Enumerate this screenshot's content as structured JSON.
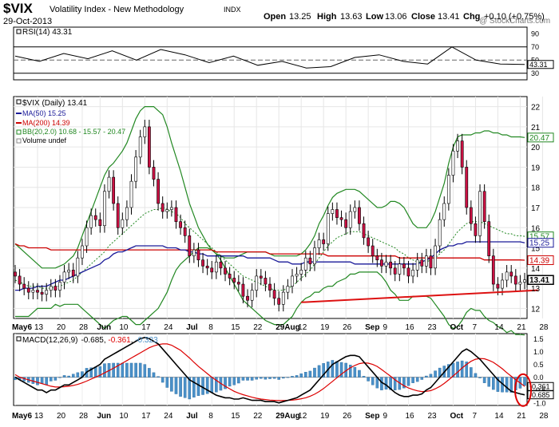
{
  "header": {
    "symbol": "$VIX",
    "name": "Volatility Index - New Methodology",
    "exchange": "INDX",
    "date": "29-Oct-2013",
    "copyright": "@ StockCharts.com",
    "open_label": "Open",
    "open": "13.25",
    "high_label": "High",
    "high": "13.63",
    "low_label": "Low",
    "low": "13.06",
    "close_label": "Close",
    "close": "13.41",
    "chg_label": "Chg",
    "chg": "+0.10 (+0.75%)"
  },
  "colors": {
    "up_candle": "#ffffff",
    "down_candle": "#cc1144",
    "ma50": "#1a1a99",
    "ma200": "#cc0000",
    "bb": "#228822",
    "bb_mid": "#228822",
    "trendline": "#dd1111",
    "macd": "#000000",
    "signal": "#dd0000",
    "histogram": "#4a90c8",
    "circle": "#dd0000"
  },
  "chart_data": [
    {
      "type": "line",
      "panel": "rsi",
      "legend": "RSI(14) 43.31",
      "yticks": [
        30,
        50,
        70,
        90
      ],
      "ylim": [
        20,
        100
      ],
      "reference_lines": [
        30,
        70
      ],
      "last_value_label": "43.31",
      "x": [
        0,
        6,
        12,
        18,
        24,
        30,
        36,
        42,
        48,
        54,
        60,
        66,
        72,
        78,
        84,
        90,
        96,
        102,
        108,
        114,
        120,
        126
      ],
      "values": [
        56,
        48,
        60,
        52,
        64,
        50,
        66,
        58,
        46,
        56,
        42,
        48,
        38,
        40,
        54,
        58,
        48,
        44,
        70,
        50,
        44,
        43.31
      ]
    },
    {
      "type": "candlestick",
      "panel": "price",
      "legend": [
        "$VIX (Daily) 13.41",
        "MA(50) 15.25",
        "MA(200) 14.39",
        "BB(20,2.0) 10.68 - 15.57 - 20.47",
        "Volume undef"
      ],
      "ylim": [
        11.5,
        22.5
      ],
      "yticks": [
        12,
        13,
        14,
        15,
        16,
        17,
        18,
        19,
        20,
        21,
        22
      ],
      "value_labels": [
        {
          "text": "20.47",
          "value": 20.47
        },
        {
          "text": "15.57",
          "value": 15.57
        },
        {
          "text": "15.25",
          "value": 15.25
        },
        {
          "text": "14.39",
          "value": 14.39
        },
        {
          "text": "13.41",
          "value": 13.41
        }
      ],
      "x_tick_labels": [
        "May6",
        "13",
        "20",
        "28",
        "Jun",
        "10",
        "17",
        "24",
        "Jul",
        "8",
        "15",
        "22",
        "29Aug",
        "12",
        "19",
        "26",
        "Sep",
        "9",
        "16",
        "23",
        "Oct",
        "7",
        "14",
        "21",
        "28"
      ],
      "x_tick_days": [
        0,
        5,
        10,
        15,
        19,
        24,
        29,
        34,
        39,
        44,
        49,
        54,
        59,
        64,
        69,
        74,
        79,
        83,
        88,
        93,
        98,
        103,
        108,
        113,
        118
      ],
      "close": [
        13.6,
        13.2,
        13.0,
        12.8,
        12.9,
        12.8,
        12.7,
        12.9,
        13.1,
        12.9,
        13.3,
        13.8,
        13.9,
        13.6,
        14.5,
        15.1,
        16.0,
        16.6,
        16.4,
        16.1,
        17.8,
        18.5,
        17.2,
        16.0,
        16.4,
        17.0,
        18.3,
        19.5,
        20.5,
        21.0,
        19.0,
        18.4,
        17.2,
        16.8,
        16.9,
        17.0,
        16.3,
        16.0,
        15.6,
        14.6,
        14.9,
        14.4,
        14.1,
        14.0,
        13.8,
        14.3,
        14.0,
        13.7,
        13.5,
        13.3,
        13.2,
        12.6,
        12.4,
        12.9,
        13.6,
        13.5,
        13.2,
        12.9,
        12.5,
        12.2,
        12.8,
        13.1,
        13.6,
        13.7,
        13.9,
        14.5,
        14.2,
        15.0,
        15.4,
        15.2,
        16.7,
        16.9,
        16.5,
        16.4,
        16.0,
        16.8,
        17.0,
        16.2,
        15.5,
        15.1,
        14.6,
        14.4,
        14.1,
        14.3,
        14.0,
        13.7,
        14.2,
        14.0,
        13.6,
        13.9,
        14.4,
        14.1,
        14.6,
        14.0,
        15.1,
        16.4,
        17.2,
        18.6,
        19.8,
        20.3,
        19.0,
        17.0,
        16.2,
        15.6,
        17.8,
        16.3,
        14.6,
        13.2,
        13.0,
        13.4,
        13.8,
        13.6,
        13.2,
        13.3,
        13.41
      ],
      "ma50": [
        12.9,
        12.9,
        13.0,
        13.0,
        13.0,
        13.1,
        13.1,
        13.1,
        13.2,
        13.3,
        13.4,
        13.4,
        13.5,
        13.6,
        13.7,
        13.8,
        13.9,
        14.0,
        14.1,
        14.2,
        14.4,
        14.5,
        14.7,
        14.8,
        14.8,
        14.9,
        15.0,
        15.1,
        15.1,
        15.1,
        15.1,
        15.1,
        15.1,
        15.1,
        15.0,
        15.0,
        15.0,
        14.9,
        14.9,
        14.8,
        14.8,
        14.7,
        14.7,
        14.6,
        14.6,
        14.6,
        14.6,
        14.6,
        14.6,
        14.6,
        14.6,
        14.6,
        14.5,
        14.5,
        14.5,
        14.5,
        14.5,
        14.5,
        14.4,
        14.3,
        14.3,
        14.3,
        14.2,
        14.2,
        14.2,
        14.3,
        14.3,
        14.3,
        14.3,
        14.3,
        14.3,
        14.3,
        14.3,
        14.3,
        14.3,
        14.3,
        14.2,
        14.2,
        14.2,
        14.2,
        14.2,
        14.2,
        14.2,
        14.2,
        14.2,
        14.2,
        14.2,
        14.2,
        14.2,
        14.2,
        14.2,
        14.3,
        14.4,
        14.5,
        14.7,
        14.9,
        15.0,
        15.1,
        15.1,
        15.2,
        15.2,
        15.3,
        15.3,
        15.3,
        15.3,
        15.3,
        15.3,
        15.3,
        15.3,
        15.3,
        15.3,
        15.3,
        15.3,
        15.3,
        15.25
      ],
      "ma200": [
        15.2,
        15.1,
        15.1,
        15.0,
        15.0,
        15.0,
        15.0,
        15.0,
        14.9,
        14.9,
        14.9,
        14.9,
        14.9,
        14.9,
        14.9,
        14.9,
        14.9,
        14.9,
        14.9,
        14.9,
        14.9,
        14.9,
        14.9,
        14.9,
        14.9,
        14.9,
        14.9,
        14.9,
        14.9,
        14.9,
        14.9,
        14.9,
        14.9,
        14.9,
        14.9,
        14.9,
        14.9,
        14.9,
        14.9,
        14.9,
        14.9,
        14.9,
        14.9,
        14.9,
        14.9,
        14.8,
        14.8,
        14.8,
        14.8,
        14.8,
        14.8,
        14.8,
        14.8,
        14.8,
        14.8,
        14.8,
        14.8,
        14.7,
        14.7,
        14.7,
        14.7,
        14.7,
        14.7,
        14.7,
        14.7,
        14.7,
        14.7,
        14.7,
        14.7,
        14.7,
        14.6,
        14.6,
        14.6,
        14.6,
        14.6,
        14.6,
        14.6,
        14.6,
        14.6,
        14.6,
        14.6,
        14.6,
        14.6,
        14.6,
        14.6,
        14.6,
        14.5,
        14.5,
        14.5,
        14.5,
        14.5,
        14.5,
        14.5,
        14.5,
        14.5,
        14.5,
        14.5,
        14.5,
        14.5,
        14.5,
        14.5,
        14.5,
        14.5,
        14.5,
        14.5,
        14.4,
        14.4,
        14.4,
        14.4,
        14.4,
        14.4,
        14.4,
        14.4,
        14.4,
        14.39
      ],
      "bb_upper": [
        15.2,
        15.0,
        14.8,
        14.6,
        14.4,
        14.2,
        14.0,
        14.0,
        14.0,
        14.0,
        14.1,
        14.2,
        14.4,
        14.6,
        15.0,
        15.6,
        16.2,
        16.8,
        17.4,
        18.0,
        18.6,
        19.0,
        19.2,
        19.5,
        19.8,
        20.2,
        20.8,
        21.4,
        21.8,
        22.0,
        22.0,
        22.0,
        21.8,
        21.6,
        21.0,
        20.2,
        19.5,
        18.8,
        18.0,
        17.2,
        16.6,
        16.0,
        15.6,
        15.2,
        14.9,
        14.7,
        14.6,
        14.5,
        14.5,
        14.5,
        14.6,
        14.7,
        14.8,
        14.8,
        14.8,
        14.8,
        14.8,
        14.7,
        14.6,
        14.6,
        14.6,
        14.6,
        14.6,
        14.6,
        14.7,
        14.9,
        15.2,
        15.6,
        16.2,
        16.6,
        17.1,
        17.5,
        17.7,
        17.8,
        17.9,
        17.9,
        17.9,
        17.8,
        17.6,
        17.4,
        17.2,
        17.0,
        17.0,
        17.1,
        17.3,
        17.3,
        17.2,
        17.0,
        16.6,
        16.2,
        16.0,
        16.0,
        16.0,
        16.3,
        16.8,
        17.5,
        18.2,
        19.2,
        20.0,
        20.5,
        20.6,
        20.6,
        20.6,
        20.7,
        20.7,
        20.8,
        20.8,
        20.7,
        20.7,
        20.6,
        20.6,
        20.5,
        20.5,
        20.5,
        20.47
      ],
      "bb_middle": [
        13.4,
        13.3,
        13.2,
        13.1,
        13.1,
        13.1,
        13.0,
        13.0,
        13.0,
        13.1,
        13.1,
        13.2,
        13.3,
        13.4,
        13.6,
        13.8,
        14.0,
        14.2,
        14.4,
        14.6,
        14.8,
        15.1,
        15.3,
        15.5,
        15.7,
        15.9,
        16.1,
        16.3,
        16.5,
        16.7,
        16.8,
        16.9,
        16.9,
        17.0,
        16.9,
        16.8,
        16.7,
        16.5,
        16.2,
        16.0,
        15.8,
        15.6,
        15.4,
        15.2,
        15.0,
        14.8,
        14.6,
        14.4,
        14.2,
        14.0,
        13.8,
        13.6,
        13.5,
        13.4,
        13.3,
        13.2,
        13.1,
        13.0,
        12.9,
        12.9,
        12.9,
        13.0,
        13.1,
        13.3,
        13.5,
        13.7,
        13.9,
        14.2,
        14.5,
        14.8,
        15.1,
        15.3,
        15.5,
        15.6,
        15.7,
        15.8,
        15.8,
        15.8,
        15.7,
        15.6,
        15.5,
        15.4,
        15.3,
        15.2,
        15.1,
        15.0,
        14.8,
        14.7,
        14.5,
        14.4,
        14.3,
        14.3,
        14.3,
        14.4,
        14.5,
        14.7,
        14.9,
        15.2,
        15.5,
        15.8,
        16.0,
        16.2,
        16.3,
        16.3,
        16.3,
        16.2,
        16.1,
        16.0,
        15.9,
        15.8,
        15.7,
        15.7,
        15.6,
        15.6,
        15.57
      ],
      "bb_lower": [
        11.6,
        11.6,
        11.6,
        11.6,
        11.8,
        12.0,
        12.0,
        12.0,
        12.0,
        12.2,
        12.1,
        12.2,
        12.2,
        12.2,
        12.2,
        12.0,
        11.8,
        11.6,
        11.4,
        11.2,
        11.0,
        11.2,
        11.4,
        11.5,
        11.6,
        11.6,
        11.4,
        11.2,
        11.2,
        11.4,
        11.6,
        11.8,
        12.0,
        12.4,
        12.8,
        13.4,
        13.9,
        14.2,
        14.4,
        14.6,
        14.8,
        15.0,
        15.0,
        15.0,
        14.9,
        14.7,
        14.4,
        14.0,
        13.6,
        13.2,
        12.8,
        12.4,
        12.2,
        12.0,
        11.8,
        11.6,
        11.4,
        11.3,
        11.2,
        11.2,
        11.2,
        11.4,
        11.6,
        12.0,
        12.3,
        12.5,
        12.6,
        12.8,
        12.8,
        13.0,
        13.1,
        13.1,
        13.3,
        13.4,
        13.5,
        13.7,
        13.7,
        13.8,
        13.8,
        13.8,
        13.8,
        13.8,
        13.6,
        13.3,
        12.9,
        12.7,
        12.4,
        12.4,
        12.4,
        12.6,
        12.6,
        12.6,
        12.6,
        12.5,
        12.2,
        11.9,
        11.6,
        11.2,
        11.0,
        11.1,
        11.4,
        11.8,
        12.0,
        11.9,
        11.9,
        11.6,
        11.4,
        11.3,
        11.1,
        11.0,
        10.8,
        10.9,
        10.7,
        10.7,
        10.68
      ],
      "trendline": {
        "x": [
          64,
          117
        ],
        "y": [
          12.3,
          12.9
        ]
      }
    },
    {
      "type": "line",
      "panel": "macd",
      "legend_prefix": "MACD(12,26,9)",
      "legend_macd": "-0.685",
      "legend_signal": "-0.361",
      "legend_hist": "-0.323",
      "ylim": [
        -1.1,
        1.7
      ],
      "yticks": [
        -1.0,
        -0.5,
        0.0,
        0.5,
        1.0
      ],
      "value_labels": [
        {
          "text": "1.5",
          "value": 1.5
        },
        {
          "text": "1.0",
          "value": 1.0
        },
        {
          "text": "0.5",
          "value": 0.5
        },
        {
          "text": "0.0",
          "value": 0.0
        },
        {
          "text": "-0.361",
          "value": -0.361
        },
        {
          "text": "-0.5",
          "value": -0.5
        },
        {
          "text": "-0.685",
          "value": -0.685
        },
        {
          "text": "-1.0",
          "value": -1.0
        }
      ],
      "macd": [
        0.0,
        -0.1,
        -0.2,
        -0.3,
        -0.4,
        -0.5,
        -0.5,
        -0.6,
        -0.5,
        -0.5,
        -0.4,
        -0.3,
        -0.3,
        -0.2,
        -0.1,
        0.0,
        0.2,
        0.3,
        0.4,
        0.5,
        0.7,
        0.8,
        0.9,
        1.0,
        1.1,
        1.2,
        1.3,
        1.4,
        1.5,
        1.55,
        1.5,
        1.4,
        1.3,
        1.1,
        0.9,
        0.7,
        0.5,
        0.3,
        0.1,
        -0.1,
        -0.2,
        -0.3,
        -0.4,
        -0.5,
        -0.6,
        -0.7,
        -0.75,
        -0.8,
        -0.8,
        -0.85,
        -0.85,
        -0.8,
        -0.85,
        -0.9,
        -0.9,
        -0.9,
        -0.95,
        -0.95,
        -0.95,
        -1.0,
        -0.95,
        -0.9,
        -0.85,
        -0.8,
        -0.7,
        -0.6,
        -0.5,
        -0.3,
        -0.1,
        0.1,
        0.3,
        0.5,
        0.6,
        0.7,
        0.8,
        0.85,
        0.85,
        0.8,
        0.6,
        0.4,
        0.2,
        0.0,
        -0.2,
        -0.3,
        -0.45,
        -0.6,
        -0.7,
        -0.75,
        -0.75,
        -0.7,
        -0.7,
        -0.65,
        -0.5,
        -0.4,
        -0.2,
        0.0,
        0.2,
        0.4,
        0.6,
        0.8,
        1.0,
        1.1,
        1.0,
        0.85,
        0.7,
        0.5,
        0.3,
        0.1,
        -0.1,
        -0.25,
        -0.4,
        -0.55,
        -0.6,
        -0.65,
        -0.685
      ],
      "signal": [
        0.1,
        0.0,
        -0.05,
        -0.1,
        -0.15,
        -0.2,
        -0.25,
        -0.3,
        -0.35,
        -0.38,
        -0.38,
        -0.37,
        -0.35,
        -0.32,
        -0.28,
        -0.22,
        -0.15,
        -0.07,
        0.0,
        0.08,
        0.17,
        0.26,
        0.35,
        0.45,
        0.55,
        0.65,
        0.75,
        0.85,
        0.95,
        1.05,
        1.15,
        1.22,
        1.27,
        1.3,
        1.3,
        1.25,
        1.15,
        1.05,
        0.9,
        0.75,
        0.58,
        0.42,
        0.28,
        0.14,
        0.0,
        -0.12,
        -0.24,
        -0.35,
        -0.45,
        -0.55,
        -0.62,
        -0.68,
        -0.73,
        -0.78,
        -0.82,
        -0.85,
        -0.87,
        -0.89,
        -0.9,
        -0.91,
        -0.91,
        -0.9,
        -0.89,
        -0.87,
        -0.84,
        -0.8,
        -0.74,
        -0.66,
        -0.56,
        -0.44,
        -0.3,
        -0.16,
        -0.02,
        0.12,
        0.25,
        0.37,
        0.46,
        0.53,
        0.56,
        0.55,
        0.5,
        0.42,
        0.3,
        0.17,
        0.04,
        -0.1,
        -0.22,
        -0.33,
        -0.42,
        -0.48,
        -0.53,
        -0.56,
        -0.55,
        -0.52,
        -0.45,
        -0.36,
        -0.24,
        -0.1,
        0.05,
        0.2,
        0.36,
        0.5,
        0.62,
        0.7,
        0.73,
        0.72,
        0.66,
        0.58,
        0.46,
        0.33,
        0.18,
        0.04,
        -0.1,
        -0.22,
        -0.361
      ]
    }
  ]
}
